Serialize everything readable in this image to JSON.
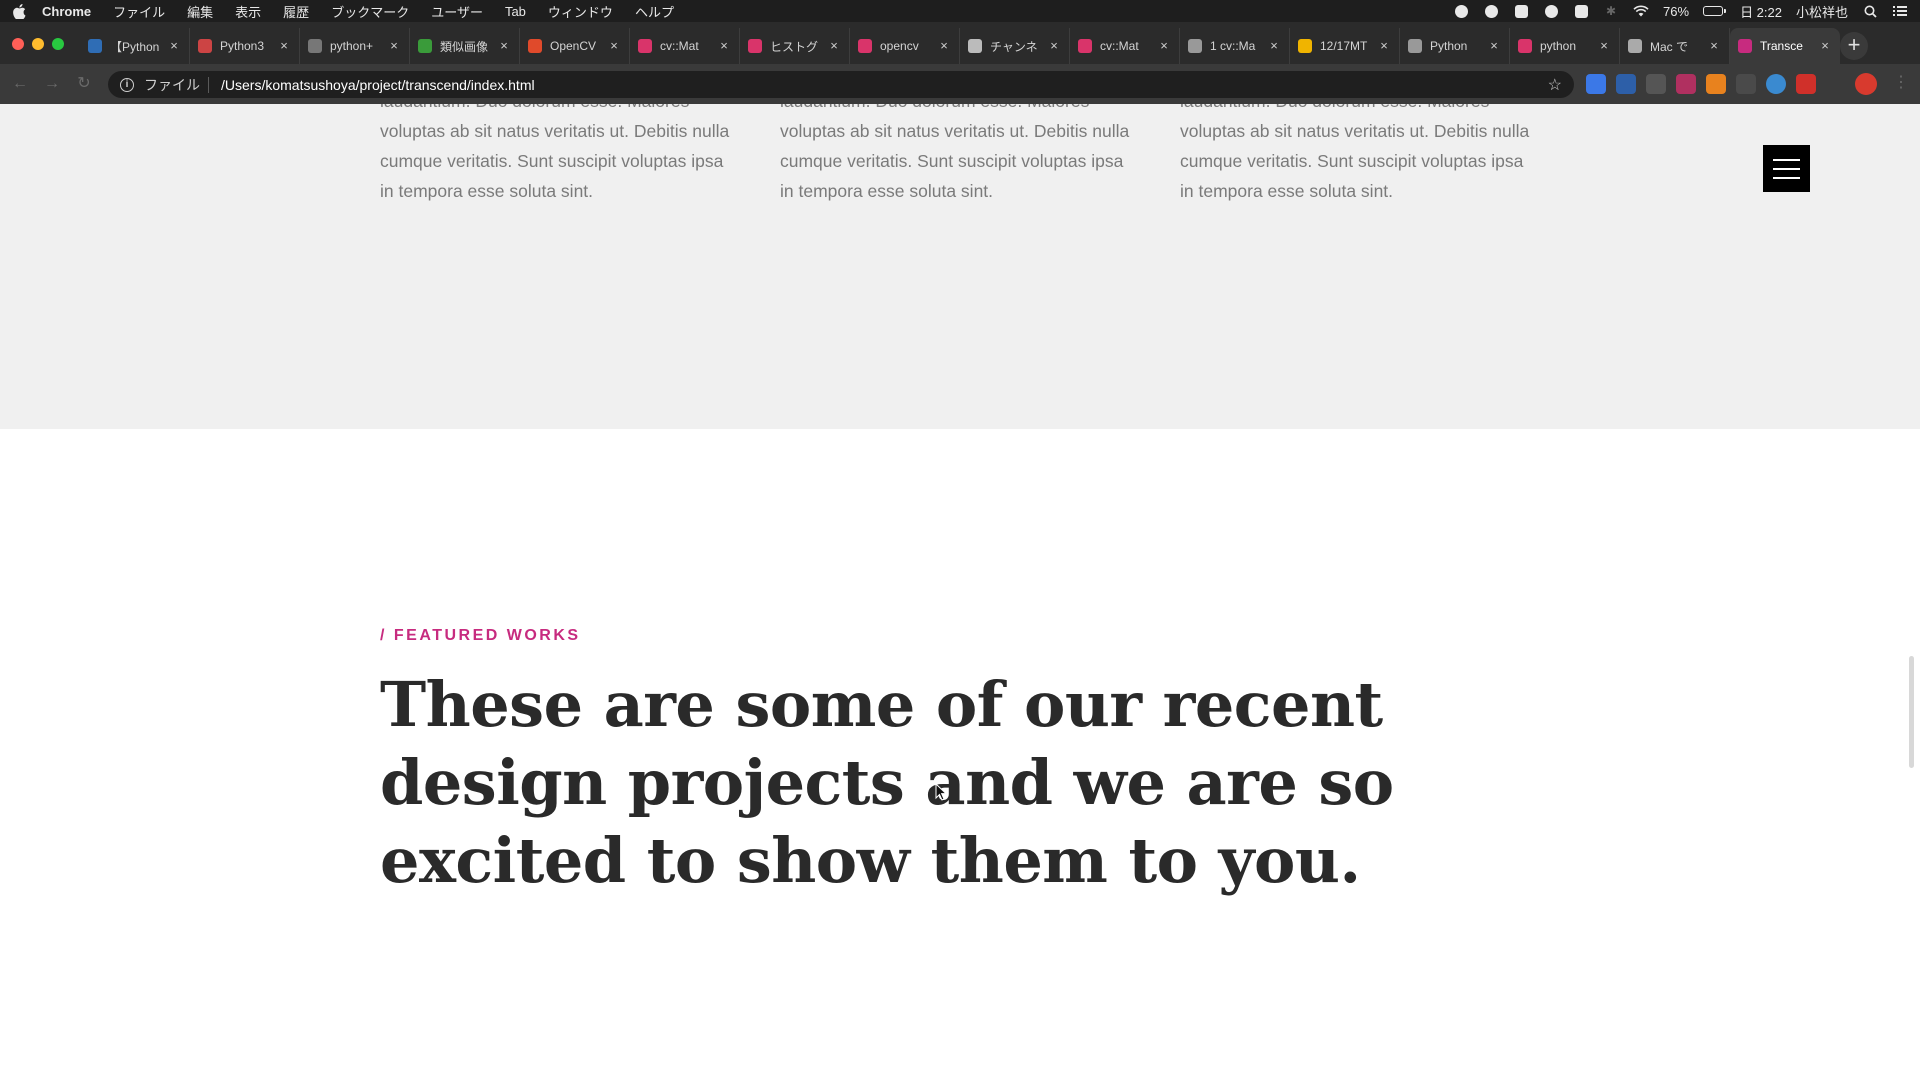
{
  "menubar": {
    "app": "Chrome",
    "items": [
      "ファイル",
      "編集",
      "表示",
      "履歴",
      "ブックマーク",
      "ユーザー",
      "Tab",
      "ウィンドウ",
      "ヘルプ"
    ],
    "battery_percent": "76%",
    "battery_level": 0.76,
    "clock": "日 2:22",
    "user": "小松祥也"
  },
  "tabs": [
    {
      "title": "【Python",
      "color": "#2f6db5"
    },
    {
      "title": "Python3",
      "color": "#c44"
    },
    {
      "title": "python+",
      "color": "#777"
    },
    {
      "title": "類似画像",
      "color": "#3a9b3a"
    },
    {
      "title": "OpenCV",
      "color": "#e04a2b"
    },
    {
      "title": "cv::Mat",
      "color": "#d9346a"
    },
    {
      "title": "ヒストグ",
      "color": "#d9346a"
    },
    {
      "title": "opencv",
      "color": "#d9346a"
    },
    {
      "title": "チャンネ",
      "color": "#bbb"
    },
    {
      "title": "cv::Mat",
      "color": "#d9346a"
    },
    {
      "title": "1 cv::Ma",
      "color": "#999"
    },
    {
      "title": "12/17MT",
      "color": "#f0b400"
    },
    {
      "title": "Python",
      "color": "#999"
    },
    {
      "title": "python",
      "color": "#d9346a"
    },
    {
      "title": "Mac で",
      "color": "#aaa"
    },
    {
      "title": "Transce",
      "color": "#c72b7f",
      "active": true
    }
  ],
  "address": {
    "scheme": "ファイル",
    "url": "/Users/komatsushoya/project/transcend/index.html"
  },
  "columns": [
    {
      "cut_line": "laudantium. Duo dolorum esse. Maiores",
      "text": "voluptas ab sit natus veritatis ut. Debitis nulla cumque veritatis. Sunt suscipit voluptas ipsa in tempora esse soluta sint."
    },
    {
      "cut_line": "laudantium. Duo dolorum esse. Maiores",
      "text": "voluptas ab sit natus veritatis ut. Debitis nulla cumque veritatis. Sunt suscipit voluptas ipsa in tempora esse soluta sint."
    },
    {
      "cut_line": "laudantium. Duo dolorum esse. Maiores",
      "text": "voluptas ab sit natus veritatis ut. Debitis nulla cumque veritatis. Sunt suscipit voluptas ipsa in tempora esse soluta sint."
    }
  ],
  "featured": {
    "eyebrow": "/ FEATURED WORKS",
    "headline": "These are some of our recent design projects and we are so excited to show them to you."
  },
  "colors": {
    "accent": "#c72b7f",
    "grey_section": "#f0f0f0",
    "headline": "#2a2a2a"
  }
}
